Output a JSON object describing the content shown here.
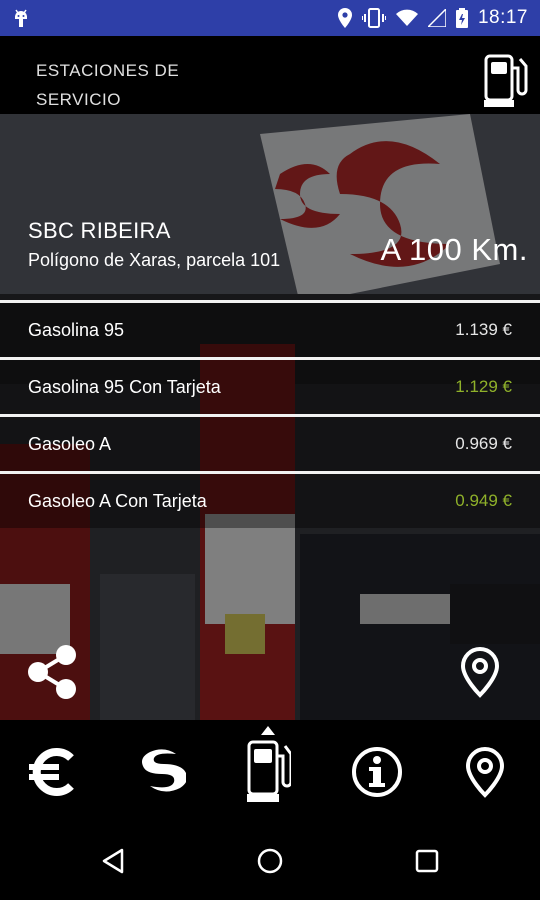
{
  "status_bar": {
    "time": "18:17",
    "icons": [
      "android-debug-icon",
      "location-icon",
      "vibrate-icon",
      "wifi-icon",
      "signal-icon",
      "battery-icon"
    ]
  },
  "header": {
    "title": "ESTACIONES DE SERVICIO",
    "icon": "fuel-pump-icon"
  },
  "station": {
    "name": "SBC RIBEIRA",
    "address": "Polígono de Xaras, parcela 101",
    "distance": "A 100 Km."
  },
  "prices": [
    {
      "name": "Gasolina 95",
      "price": "1.139 €",
      "card": false
    },
    {
      "name": "Gasolina 95 Con Tarjeta",
      "price": "1.129 €",
      "card": true
    },
    {
      "name": "Gasoleo A",
      "price": "0.969 €",
      "card": false
    },
    {
      "name": "Gasoleo A Con Tarjeta",
      "price": "0.949 €",
      "card": true
    }
  ],
  "colors": {
    "status_bar": "#2e3fa8",
    "card_price": "#8fb12a",
    "background": "#000000"
  },
  "tabs": [
    {
      "icon": "euro-icon",
      "active": false
    },
    {
      "icon": "sbc-logo-icon",
      "active": false
    },
    {
      "icon": "fuel-pump-icon",
      "active": true
    },
    {
      "icon": "info-icon",
      "active": false
    },
    {
      "icon": "location-pin-icon",
      "active": false
    }
  ],
  "nav": [
    "back-icon",
    "home-icon",
    "recents-icon"
  ]
}
